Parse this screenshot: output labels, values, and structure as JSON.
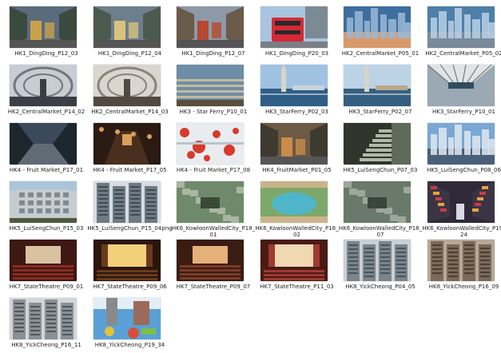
{
  "files": [
    {
      "name": "HK1_DingDing_P12_03",
      "kind": "street-tram",
      "c1": "#5a6b7c",
      "c2": "#c8a24b",
      "c3": "#3b4a3e"
    },
    {
      "name": "HK1_DingDing_P12_04",
      "kind": "street-tram",
      "c1": "#6d7f8c",
      "c2": "#d9c27a",
      "c3": "#4b5a4e"
    },
    {
      "name": "HK1_DingDing_P12_07",
      "kind": "street-bus",
      "c1": "#8c9aa8",
      "c2": "#b5492f",
      "c3": "#6a5a4a"
    },
    {
      "name": "HK1_DingDing_P20_03",
      "kind": "red-bus",
      "c1": "#a9c4de",
      "c2": "#d62936",
      "c3": "#7a7e86"
    },
    {
      "name": "HK2_CentralMarket_P05_01",
      "kind": "skyline",
      "c1": "#3e6e9e",
      "c2": "#9ab8d6",
      "c3": "#d99a6b"
    },
    {
      "name": "HK2_CentralMarket_P05_02",
      "kind": "skyline",
      "c1": "#4d7fa8",
      "c2": "#b8d0e6",
      "c3": "#7a8a9a"
    },
    {
      "name": "HK2_CentralMarket_P14_02",
      "kind": "interior-arch",
      "c1": "#c9ccd2",
      "c2": "#6f7780",
      "c3": "#3a3f46"
    },
    {
      "name": "HK2_CentralMarket_P14_03",
      "kind": "interior-arch",
      "c1": "#d8d6cf",
      "c2": "#8a8478",
      "c3": "#504a40"
    },
    {
      "name": "HK3 - Star Ferry_P10_01",
      "kind": "pier-top",
      "c1": "#6c8ea6",
      "c2": "#c6b99c",
      "c3": "#5a4e3e"
    },
    {
      "name": "HK3_StarFerry_P02_03",
      "kind": "harbour-tower",
      "c1": "#9fc2e3",
      "c2": "#2f5e86",
      "c3": "#c9d4dc"
    },
    {
      "name": "HK3_StarFerry_P02_07",
      "kind": "harbour-tower",
      "c1": "#bcd3e6",
      "c2": "#355f80",
      "c3": "#b8a98a"
    },
    {
      "name": "HK3_StarFerry_P10_01",
      "kind": "pier-corridor",
      "c1": "#9aa9b3",
      "c2": "#e0e4e6",
      "c3": "#2f4d5e"
    },
    {
      "name": "HK4 - Fruit Market_P17_01",
      "kind": "tunnel-dark",
      "c1": "#3a4a5a",
      "c2": "#8e9aa6",
      "c3": "#1e262e"
    },
    {
      "name": "HK4 - Fruit Market_P17_05",
      "kind": "alley-warm",
      "c1": "#4a2e1e",
      "c2": "#d7a15a",
      "c3": "#2a1a12"
    },
    {
      "name": "HK4 - Fruit Market_P17_08",
      "kind": "red-spots",
      "c1": "#e9ecef",
      "c2": "#d83a2c",
      "c3": "#b9c4cc"
    },
    {
      "name": "HK4_FruitMarket_P01_05",
      "kind": "street-tram",
      "c1": "#6b5a44",
      "c2": "#c98c4a",
      "c3": "#3e3a30"
    },
    {
      "name": "HK5_LuiSengChun_P07_03",
      "kind": "stairs",
      "c1": "#5e6b5a",
      "c2": "#b0b8a8",
      "c3": "#2f352c"
    },
    {
      "name": "HK5_LuiSengChun_P08_06",
      "kind": "skyline",
      "c1": "#7aa7d4",
      "c2": "#dfe8f0",
      "c3": "#4a6078"
    },
    {
      "name": "HK5_LuiSengChun_P15_03",
      "kind": "building-front",
      "c1": "#c7ccd0",
      "c2": "#7d8a94",
      "c3": "#4d5a3e"
    },
    {
      "name": "HK5_LuiSengChun_P15_04png",
      "kind": "tower-block",
      "c1": "#d6dde2",
      "c2": "#6e7a84",
      "c3": "#3f4a52"
    },
    {
      "name": "HK6_KowloonWalledCity_P18_01",
      "kind": "aerial-green",
      "c1": "#6f8a6a",
      "c2": "#b6c0b0",
      "c3": "#3a4a36"
    },
    {
      "name": "HK6_KowloonWalledCity_P18_02",
      "kind": "pool",
      "c1": "#4fb6c9",
      "c2": "#7ea86a",
      "c3": "#c9b48a"
    },
    {
      "name": "HK6_KowloonWalledCity_P18_07",
      "kind": "aerial-green",
      "c1": "#6a7a6a",
      "c2": "#aab4a8",
      "c3": "#3a463a"
    },
    {
      "name": "HK6_KowloonWalledCity_P19_24",
      "kind": "night-street",
      "c1": "#2e2a3a",
      "c2": "#e8a23a",
      "c3": "#c93a4a"
    },
    {
      "name": "HK7_StateTheatre_P09_01",
      "kind": "theatre-red",
      "c1": "#8a2a24",
      "c2": "#d8c2a0",
      "c3": "#3e1812"
    },
    {
      "name": "HK7_StateTheatre_P09_06",
      "kind": "theatre-stage",
      "c1": "#6a3a1e",
      "c2": "#f2d07a",
      "c3": "#2a160c"
    },
    {
      "name": "HK7_StateTheatre_P09_07",
      "kind": "theatre-red",
      "c1": "#7a3a28",
      "c2": "#e6b07a",
      "c3": "#3a1c12"
    },
    {
      "name": "HK7_StateTheatre_P11_03",
      "kind": "theatre-stage",
      "c1": "#a03a30",
      "c2": "#f0d8b0",
      "c3": "#4a1a14"
    },
    {
      "name": "HK8_YickCheong_P04_05",
      "kind": "tower-block",
      "c1": "#c9cfd4",
      "c2": "#7a848c",
      "c3": "#4a545c"
    },
    {
      "name": "HK8_YickCheong_P16_09",
      "kind": "tower-block",
      "c1": "#b8a896",
      "c2": "#7a6a5a",
      "c3": "#4a3e34"
    },
    {
      "name": "HK8_YickCheong_P16_11",
      "kind": "tower-block",
      "c1": "#d2d6da",
      "c2": "#8a9096",
      "c3": "#50565c"
    },
    {
      "name": "HK8_YickCheong_P19_34",
      "kind": "graffiti",
      "c1": "#5aa0d6",
      "c2": "#e6c23a",
      "c3": "#d6503a"
    }
  ]
}
